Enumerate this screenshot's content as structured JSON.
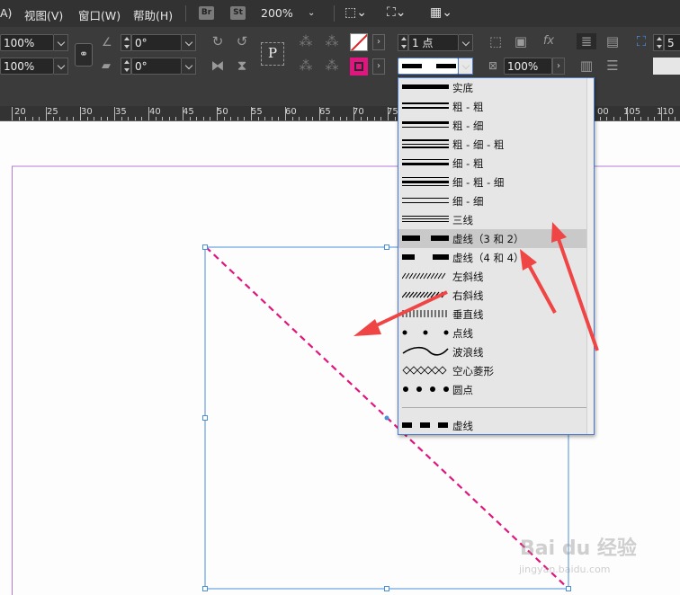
{
  "menubar": {
    "items": [
      "A)",
      "视图(V)",
      "窗口(W)",
      "帮助(H)"
    ],
    "bridge_label": "Br",
    "stock_label": "St",
    "zoom": "200%"
  },
  "control": {
    "scale_x": "100%",
    "scale_y": "100%",
    "rotate": "0°",
    "shear": "0°",
    "stroke_weight": "1 点",
    "opacity": "100%",
    "right_value": "5"
  },
  "ruler": {
    "ticks": [
      "20",
      "25",
      "30",
      "35",
      "40",
      "45",
      "50",
      "55",
      "60",
      "65",
      "70",
      "75",
      "00",
      "105",
      "110",
      "115"
    ]
  },
  "stroke_menu": {
    "items": [
      "实底",
      "粗 - 粗",
      "粗 - 细",
      "粗 - 细 - 粗",
      "细 - 粗",
      "细 - 粗 - 细",
      "细 - 细",
      "三线",
      "虚线（3 和 2）",
      "虚线（4 和 4）",
      "左斜线",
      "右斜线",
      "垂直线",
      "点线",
      "波浪线",
      "空心菱形",
      "圆点"
    ],
    "footer_item": "虚线",
    "selected_index": 8
  },
  "colors": {
    "stroke_accent": "#e0157f",
    "arrow": "#ef4545",
    "frame": "#4a90d9"
  },
  "watermark": {
    "brand": "Bai du 经验",
    "url": "jingyan.baidu.com"
  }
}
